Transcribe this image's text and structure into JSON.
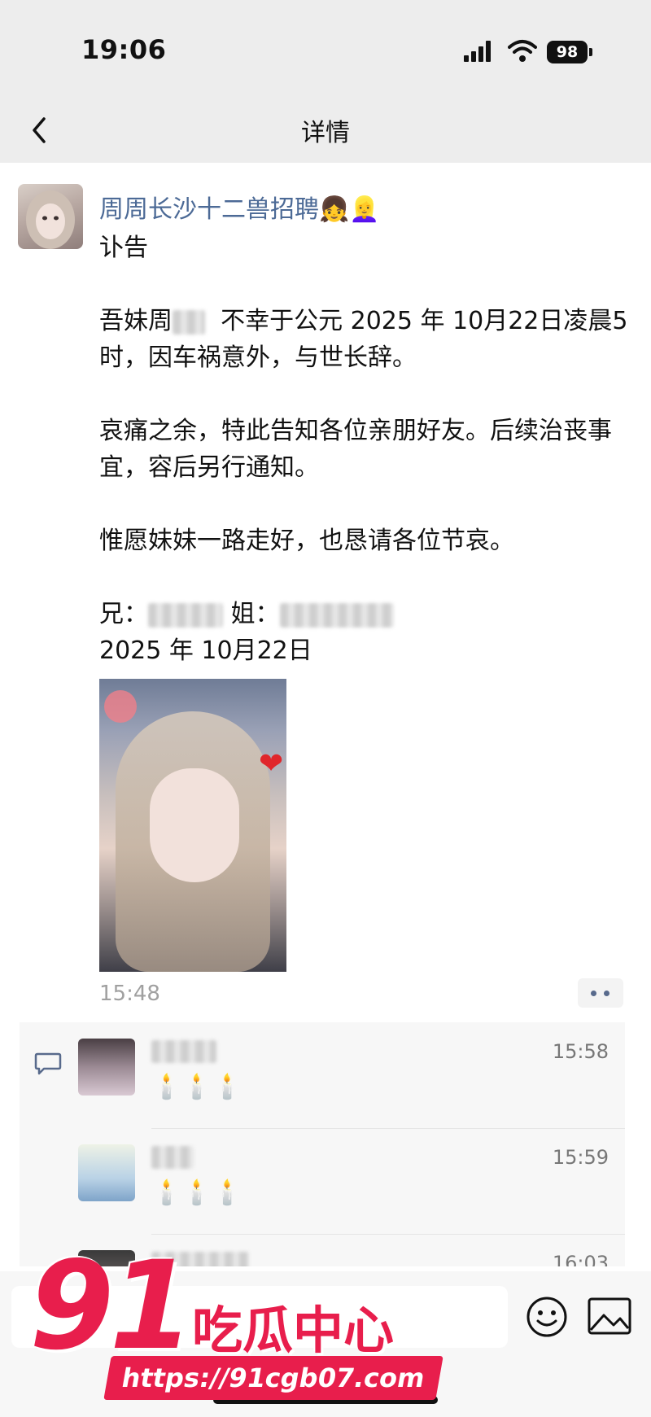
{
  "status_bar": {
    "time": "19:06",
    "battery": "98"
  },
  "nav": {
    "title": "详情"
  },
  "post": {
    "author": "周周长沙十二兽招聘",
    "author_emoji": "👧👱‍♀️",
    "title": "讣告",
    "para1_a": "吾妹周",
    "para1_b": "不幸于公元 2025 年 10月22日凌晨5时，因车祸意外，与世长辞。",
    "para2": "哀痛之余，特此告知各位亲朋好友。后续治丧事宜，容后另行通知。",
    "para3": "惟愿妹妹一路走好，也恳请各位节哀。",
    "brother_label": "兄：",
    "sister_label": "姐：",
    "date": "2025 年 10月22日",
    "time": "15:48"
  },
  "comments": [
    {
      "text": "🕯️🕯️🕯️",
      "time": "15:58"
    },
    {
      "text": "🕯️🕯️🕯️",
      "time": "15:59"
    },
    {
      "text": "",
      "time": "16:03"
    }
  ],
  "watermark": {
    "number": "91",
    "name": "吃瓜中心",
    "url": "https://91cgb07.com"
  },
  "colors": {
    "link": "#4c6a96",
    "background": "#ededed",
    "watermark": "#e81e4c"
  }
}
